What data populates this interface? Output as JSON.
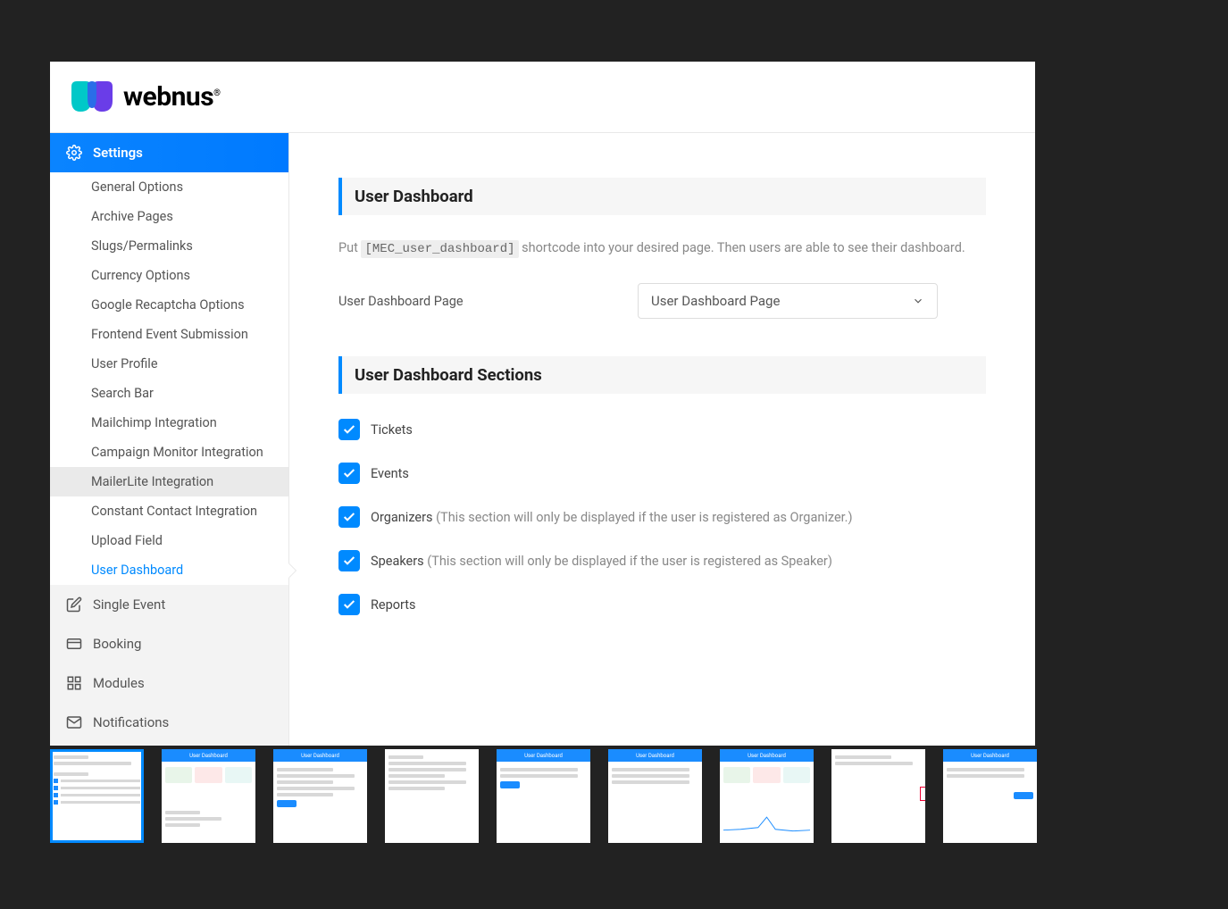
{
  "brand": {
    "name": "webnus",
    "reg": "®"
  },
  "sidebar": {
    "active_main": "Settings",
    "main_items": [
      {
        "id": "settings",
        "label": "Settings"
      },
      {
        "id": "single-event",
        "label": "Single Event"
      },
      {
        "id": "booking",
        "label": "Booking"
      },
      {
        "id": "modules",
        "label": "Modules"
      },
      {
        "id": "notifications",
        "label": "Notifications"
      }
    ],
    "settings_sub": [
      {
        "id": "general-options",
        "label": "General Options"
      },
      {
        "id": "archive-pages",
        "label": "Archive Pages"
      },
      {
        "id": "slugs-permalinks",
        "label": "Slugs/Permalinks"
      },
      {
        "id": "currency-options",
        "label": "Currency Options"
      },
      {
        "id": "google-recaptcha-options",
        "label": "Google Recaptcha Options"
      },
      {
        "id": "frontend-event-submission",
        "label": "Frontend Event Submission"
      },
      {
        "id": "user-profile",
        "label": "User Profile"
      },
      {
        "id": "search-bar",
        "label": "Search Bar"
      },
      {
        "id": "mailchimp-integration",
        "label": "Mailchimp Integration"
      },
      {
        "id": "campaign-monitor-integration",
        "label": "Campaign Monitor Integration"
      },
      {
        "id": "mailerlite-integration",
        "label": "MailerLite Integration"
      },
      {
        "id": "constant-contact-integration",
        "label": "Constant Contact Integration"
      },
      {
        "id": "upload-field",
        "label": "Upload Field"
      },
      {
        "id": "user-dashboard",
        "label": "User Dashboard"
      }
    ]
  },
  "main": {
    "section1_title": "User Dashboard",
    "help_prefix": "Put ",
    "shortcode": "[MEC_user_dashboard]",
    "help_suffix": " shortcode into your desired page. Then users are able to see their dashboard.",
    "page_field_label": "User Dashboard Page",
    "page_select_value": "User Dashboard Page",
    "section2_title": "User Dashboard Sections",
    "checkboxes": [
      {
        "id": "tickets",
        "label": "Tickets",
        "hint": "",
        "checked": true
      },
      {
        "id": "events",
        "label": "Events",
        "hint": "",
        "checked": true
      },
      {
        "id": "organizers",
        "label": "Organizers",
        "hint": " (This section will only be displayed if the user is registered as Organizer.)",
        "checked": true
      },
      {
        "id": "speakers",
        "label": "Speakers",
        "hint": " (This section will only be displayed if the user is registered as Speaker)",
        "checked": true
      },
      {
        "id": "reports",
        "label": "Reports",
        "hint": "",
        "checked": true
      }
    ]
  },
  "thumbs": {
    "label": "User Dashboard",
    "active_index": 0,
    "count": 9
  }
}
